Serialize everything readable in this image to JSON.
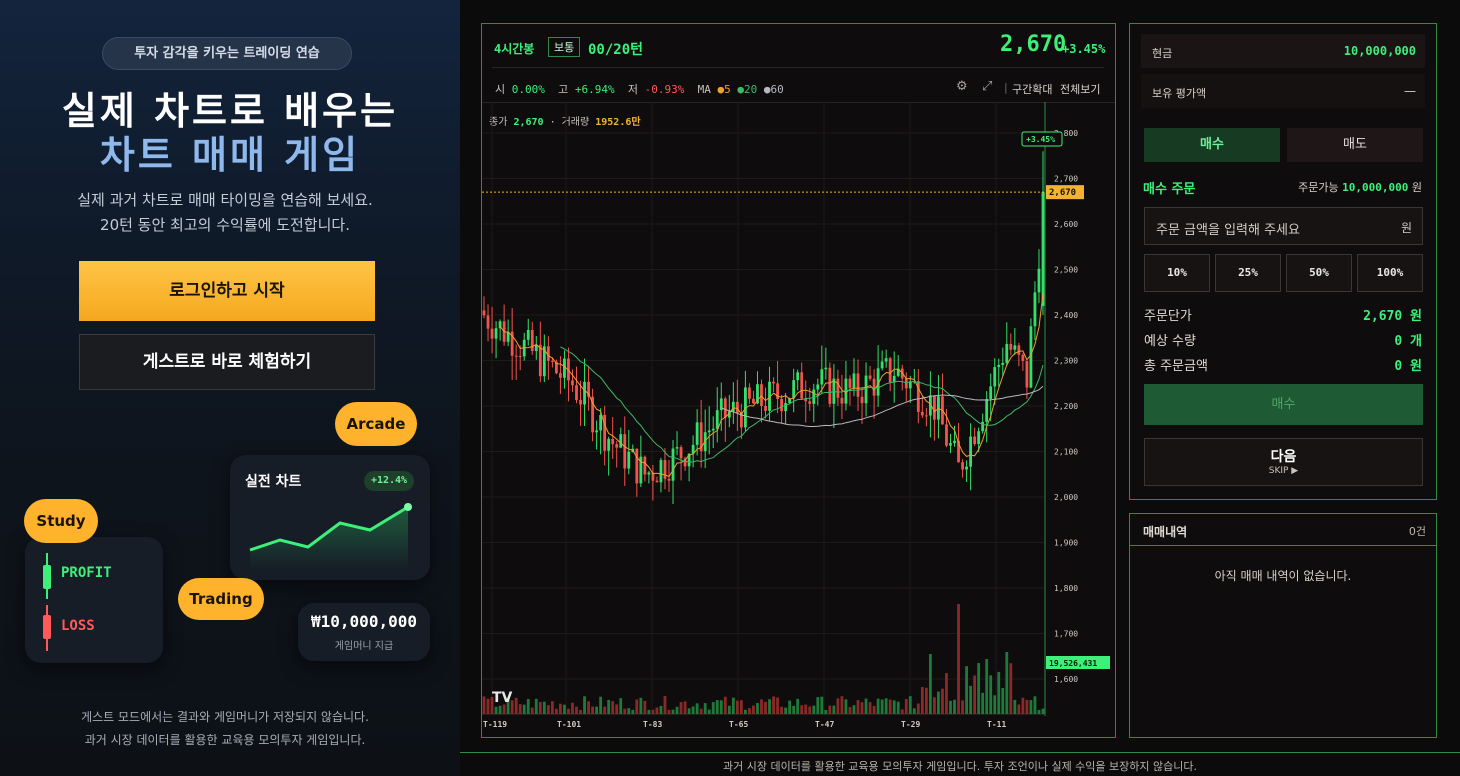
{
  "left": {
    "pill": "투자 감각을 키우는 트레이딩 연습",
    "title_line1": "실제 차트로 배우는",
    "title_line2": "차트 매매 게임",
    "desc_line1": "실제 과거 차트로 매매 타이밍을 연습해 보세요.",
    "desc_line2": "20턴 동안 최고의 수익률에 도전합니다.",
    "login_button": "로그인하고 시작",
    "guest_button": "게스트로 바로 체험하기",
    "tags": {
      "arcade": "Arcade",
      "study": "Study",
      "trading": "Trading"
    },
    "card_chart": {
      "title": "실전 차트",
      "badge": "+12.4%"
    },
    "card_legend": {
      "profit": "PROFIT",
      "loss": "LOSS"
    },
    "card_money": {
      "amount": "₩10,000,000",
      "label": "게임머니 지급"
    },
    "foot_line1": "게스트 모드에서는 결과와 게임머니가 저장되지 않습니다.",
    "foot_line2": "과거 시장 데이터를 활용한 교육용 모의투자 게임입니다."
  },
  "chart_header": {
    "timeframe": "4시간봉",
    "mode_badge": "보통",
    "turn": "00/20턴",
    "price": "2,670",
    "change": "+3.45%",
    "open_label": "시",
    "open_val": "0.00%",
    "high_label": "고",
    "high_val": "+6.94%",
    "low_label": "저",
    "low_val": "-0.93%",
    "ma_label": "MA",
    "ma5": "5",
    "ma20": "20",
    "ma60": "60",
    "zoom_label": "구간확대",
    "fullscreen_label": "전체보기"
  },
  "chart_data": {
    "type": "candlestick",
    "close_label": "종가",
    "close_val": "2,670",
    "volume_label": "거래량",
    "volume_val": "1952.6만",
    "price_badge": "2,670",
    "change_badge": "+3.45%",
    "volume_badge": "19,526,431",
    "ylim": [
      1600,
      2800
    ],
    "y_ticks": [
      "2,800",
      "2,700",
      "2,600",
      "2,500",
      "2,400",
      "2,300",
      "2,200",
      "2,100",
      "2,000",
      "1,900",
      "1,800",
      "1,700",
      "1,600"
    ],
    "x_ticks": [
      "T-119",
      "T-101",
      "T-83",
      "T-65",
      "T-47",
      "T-29",
      "T-11"
    ],
    "colors": {
      "up": "#33e06b",
      "down": "#f0544c",
      "ma5": "#f0a030",
      "ma20": "#3fb86a",
      "ma60": "#b8b8c0",
      "grid": "#1e1a18"
    }
  },
  "side": {
    "cash_label": "현금",
    "cash_val": "10,000,000",
    "holding_label": "보유 평가액",
    "holding_val": "—",
    "buy_tab": "매수",
    "sell_tab": "매도",
    "order_title": "매수 주문",
    "available_label": "주문가능",
    "available_val": "10,000,000",
    "available_unit": "원",
    "input_placeholder": "주문 금액을 입력해 주세요",
    "input_unit": "원",
    "pct": [
      "10%",
      "25%",
      "50%",
      "100%"
    ],
    "unit_price_label": "주문단가",
    "unit_price_val": "2,670 원",
    "qty_label": "예상 수량",
    "qty_val": "0 개",
    "total_label": "총 주문금액",
    "total_val": "0 원",
    "submit_button": "매수",
    "next_button": "다음",
    "next_sub": "SKIP ▶"
  },
  "history": {
    "title": "매매내역",
    "count": "0건",
    "empty": "아직 매매 내역이 없습니다."
  },
  "footer": "과거 시장 데이터를 활용한 교육용 모의투자 게임입니다. 투자 조언이나 실제 수익을 보장하지 않습니다."
}
